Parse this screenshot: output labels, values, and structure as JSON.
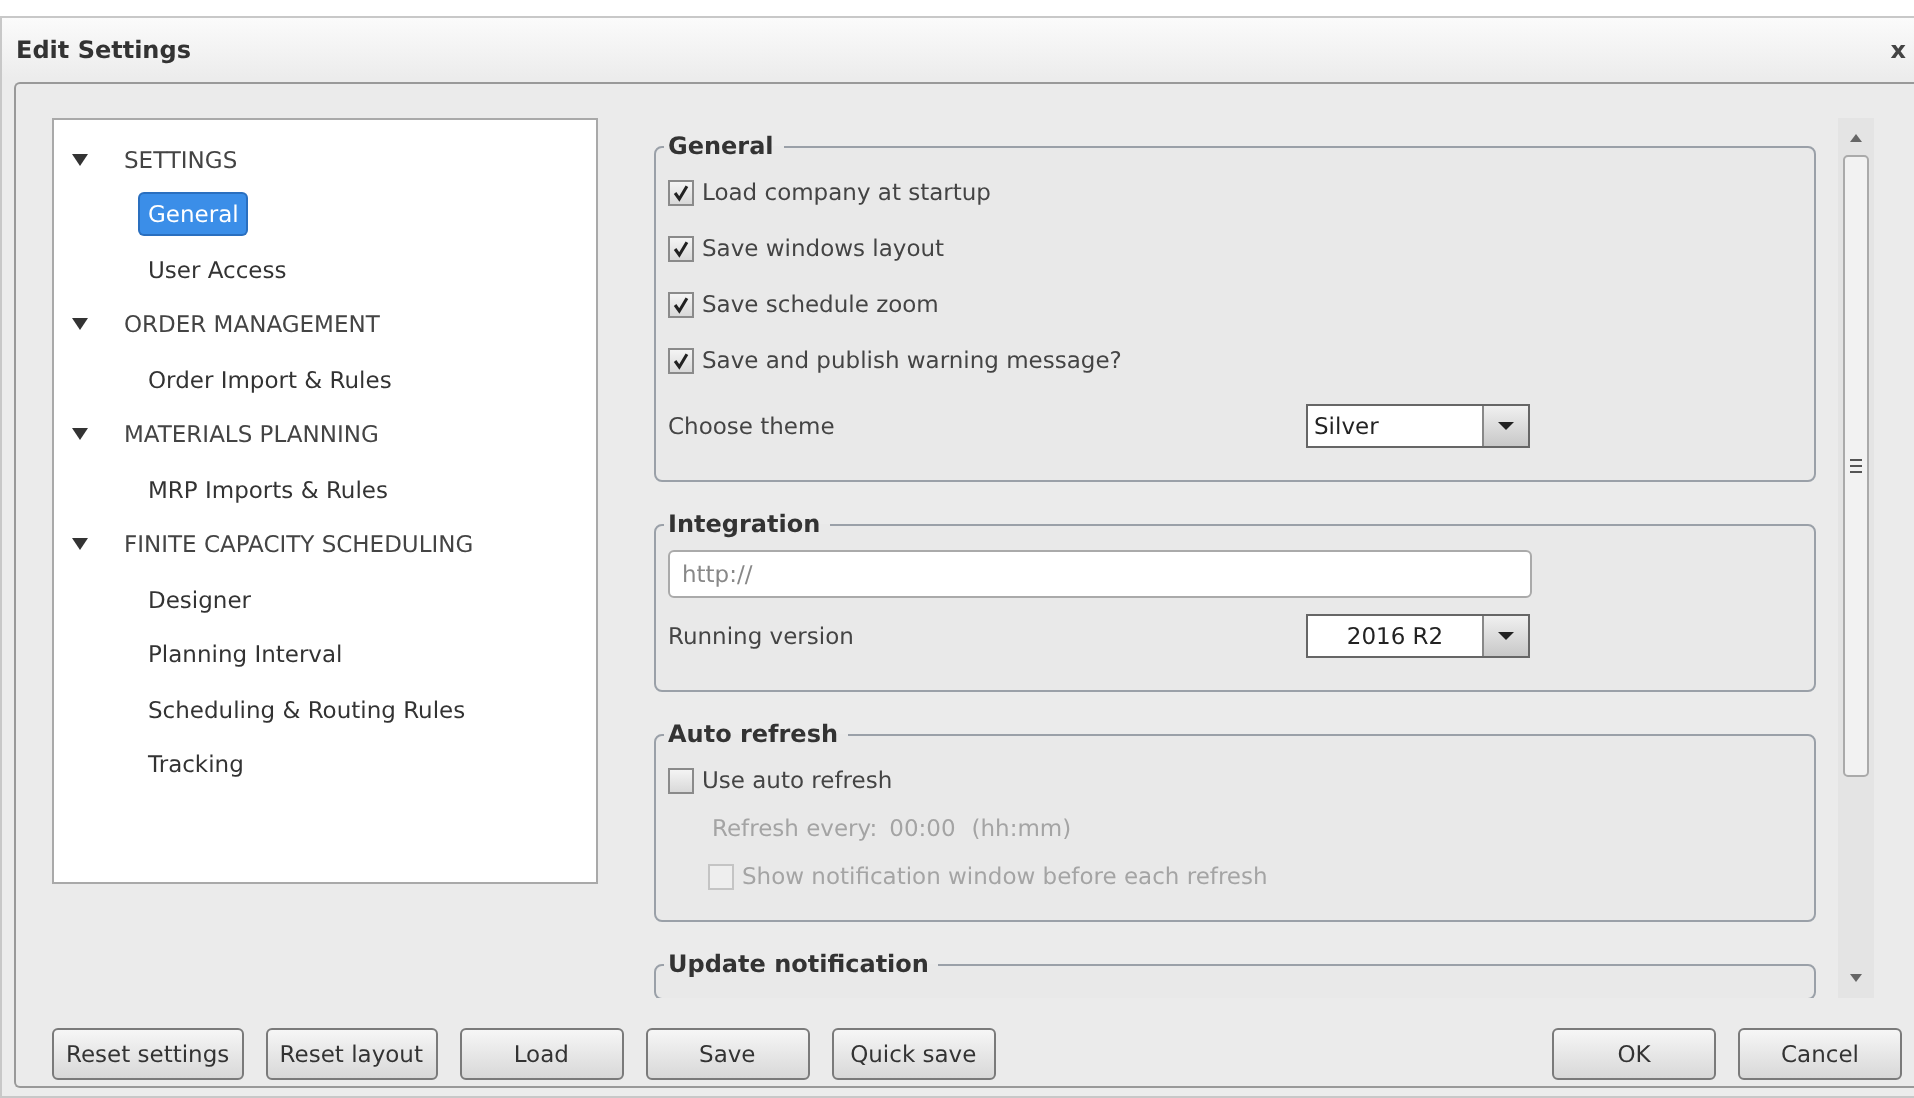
{
  "window": {
    "title": "Edit Settings",
    "close": "x"
  },
  "tree": [
    {
      "label": "SETTINGS",
      "expanded": true,
      "selected": false,
      "children": [
        {
          "label": "General",
          "selected": true
        },
        {
          "label": "User Access",
          "selected": false
        }
      ]
    },
    {
      "label": "ORDER MANAGEMENT",
      "expanded": true,
      "selected": false,
      "children": [
        {
          "label": "Order Import & Rules",
          "selected": false
        }
      ]
    },
    {
      "label": "MATERIALS PLANNING",
      "expanded": true,
      "selected": false,
      "children": [
        {
          "label": "MRP Imports & Rules",
          "selected": false
        }
      ]
    },
    {
      "label": "FINITE CAPACITY SCHEDULING",
      "expanded": true,
      "selected": false,
      "children": [
        {
          "label": "Designer",
          "selected": false
        },
        {
          "label": "Planning Interval",
          "selected": false
        },
        {
          "label": "Scheduling & Routing Rules",
          "selected": false
        },
        {
          "label": "Tracking",
          "selected": false
        }
      ]
    }
  ],
  "groups": [
    {
      "title": "General",
      "rows": [
        {
          "kind": "checkbox",
          "label": "Load company at startup",
          "checked": true,
          "disabled": false
        },
        {
          "kind": "checkbox",
          "label": "Save windows layout",
          "checked": true,
          "disabled": false
        },
        {
          "kind": "checkbox",
          "label": "Save schedule zoom",
          "checked": true,
          "disabled": false
        },
        {
          "kind": "checkbox",
          "label": "Save and publish warning message?",
          "checked": true,
          "disabled": false
        },
        {
          "kind": "dropdown",
          "label": "Choose theme",
          "value": "Silver",
          "disabled": false
        }
      ]
    },
    {
      "title": "Integration",
      "rows": [
        {
          "kind": "text",
          "placeholder": "http://",
          "disabled": false
        },
        {
          "kind": "dropdown",
          "label": "Running version",
          "value": "2016 R2",
          "disabled": false
        }
      ]
    },
    {
      "title": "Auto refresh",
      "rows": [
        {
          "kind": "checkbox",
          "label": "Use auto refresh",
          "checked": false,
          "disabled": false
        },
        {
          "kind": "interval",
          "label": "Refresh every:",
          "value": "00:00",
          "hint": "(hh:mm)",
          "disabled": true
        },
        {
          "kind": "checkbox",
          "label": "Show notification window before each refresh",
          "checked": false,
          "disabled": true
        }
      ]
    },
    {
      "title": "Update notification"
    }
  ],
  "buttons_left": [
    "Reset settings",
    "Reset layout",
    "Load",
    "Save",
    "Quick save"
  ],
  "buttons_right": [
    "OK",
    "Cancel"
  ]
}
